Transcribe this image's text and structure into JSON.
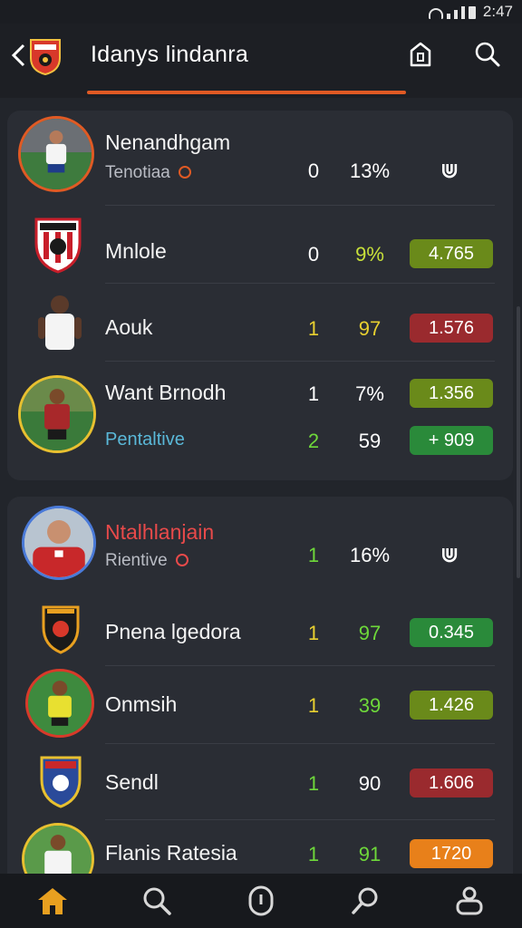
{
  "status": {
    "time": "2:47"
  },
  "header": {
    "title": "Idanys lindanra"
  },
  "colors": {
    "accent": "#e05a24",
    "pill_olive": "#6a8a1a",
    "pill_red": "#9a2a2e",
    "pill_green": "#2a8a3a",
    "pill_orange": "#e8801a",
    "yellow": "#e8d030",
    "green": "#6ed83a",
    "lime": "#c8e03a"
  },
  "card1": {
    "rows": [
      {
        "name": "Nenandhgam",
        "sub": "Tenotiaa",
        "a": "0",
        "b": "13%",
        "icon": "u-icon"
      },
      {
        "name": "Mnlole",
        "a": "0",
        "b": "9%",
        "pill": "4.765"
      },
      {
        "name": "Aouk",
        "a": "1",
        "b": "97",
        "pill": "1.576"
      },
      {
        "name": "Want Brnodh",
        "a": "1",
        "b": "7%",
        "pill": "1.356"
      },
      {
        "name": "Pentaltive",
        "a": "2",
        "b": "59",
        "pill": "+ 909"
      }
    ]
  },
  "card2": {
    "rows": [
      {
        "name": "Ntalhlanjain",
        "sub": "Rientive",
        "a": "1",
        "b": "16%",
        "icon": "u-icon"
      },
      {
        "name": "Pnena lgedora",
        "a": "1",
        "b": "97",
        "pill": "0.345"
      },
      {
        "name": "Onmsih",
        "a": "1",
        "b": "39",
        "pill": "1.426"
      },
      {
        "name": "Sendl",
        "a": "1",
        "b": "90",
        "pill": "1.606"
      },
      {
        "name": "Flanis Ratesia",
        "a": "1",
        "b": "91",
        "pill": "1720"
      }
    ]
  },
  "nav": [
    "home-icon",
    "search-icon",
    "shield-icon",
    "explore-icon",
    "profile-icon"
  ]
}
